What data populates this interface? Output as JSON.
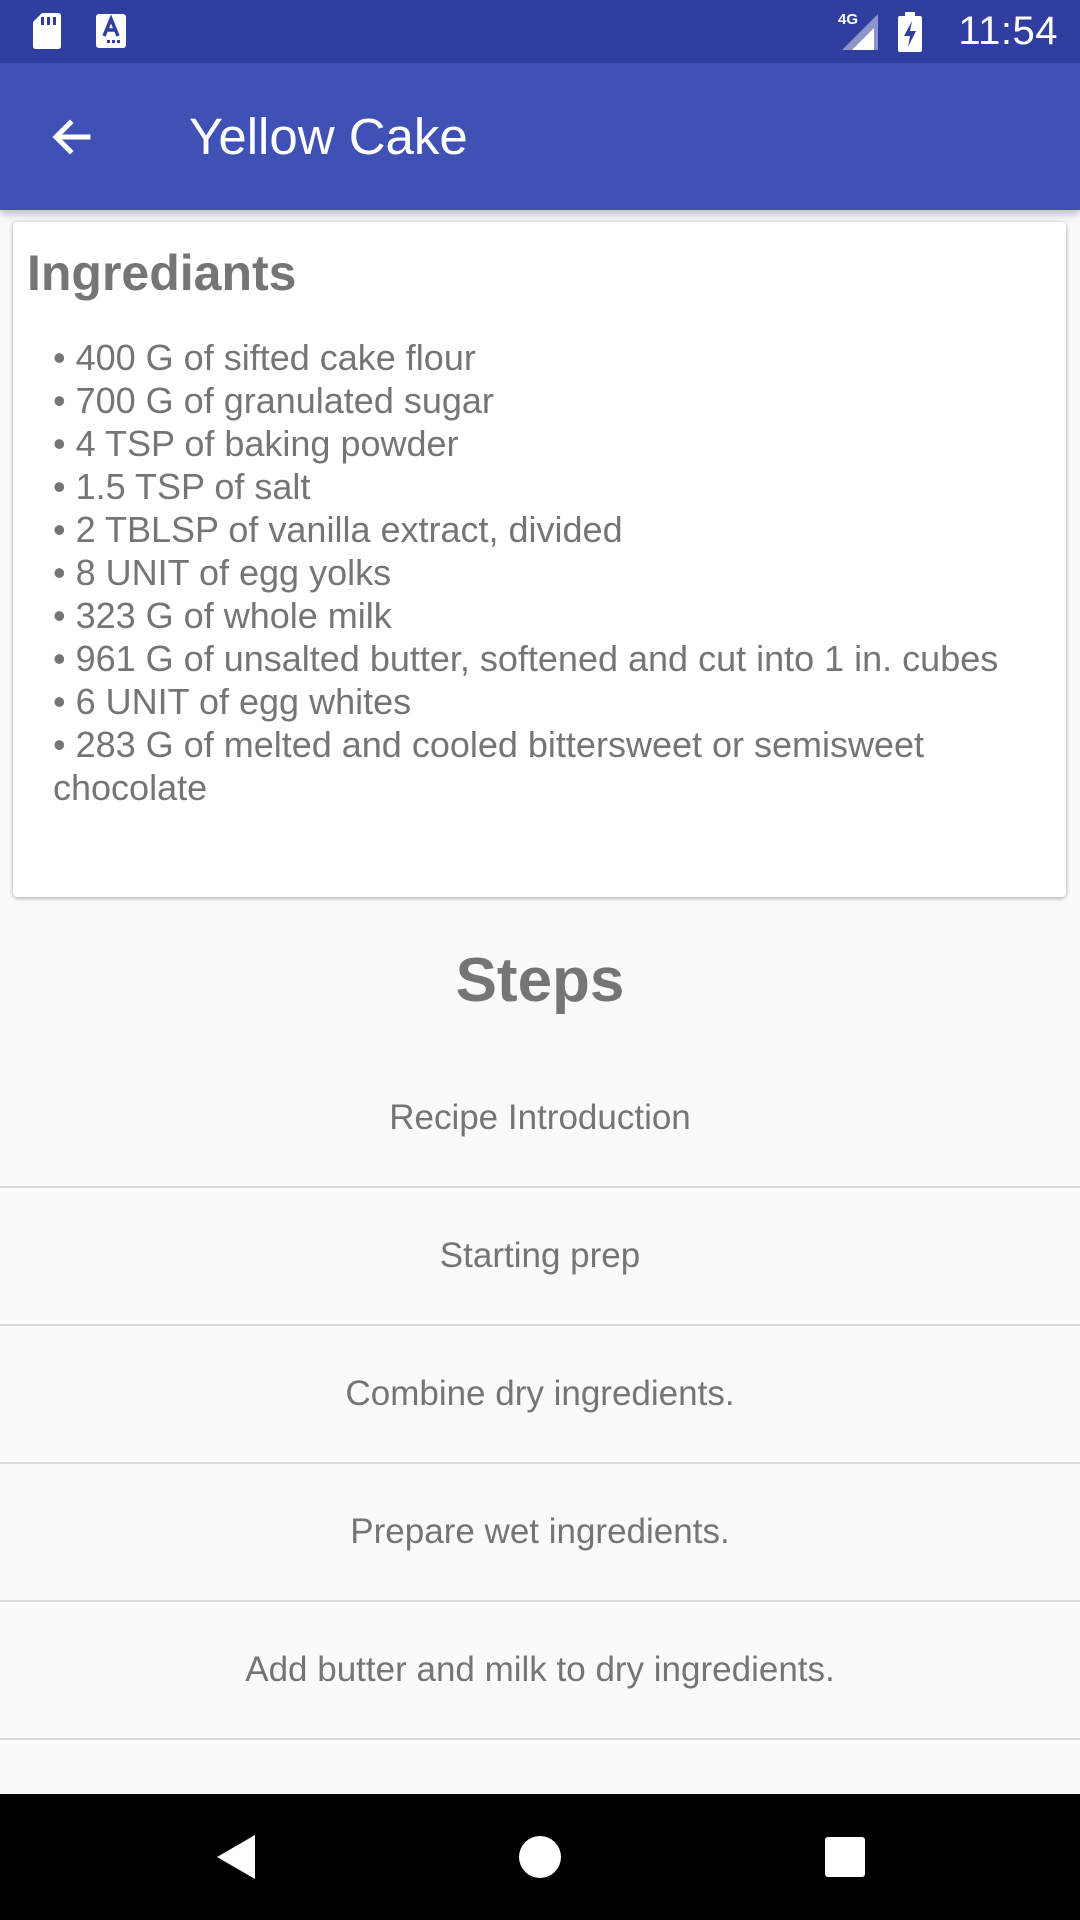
{
  "status_bar": {
    "time": "11:54",
    "network": "4G",
    "icons": [
      "sd-card-icon",
      "keyboard-a-icon",
      "signal-4g-icon",
      "battery-charging-icon"
    ]
  },
  "app_bar": {
    "title": "Yellow Cake",
    "back_icon": "arrow-back-icon"
  },
  "ingredients": {
    "heading": "Ingrediants",
    "items": [
      "400 G of sifted cake flour",
      "700 G of granulated sugar",
      "4 TSP of baking powder",
      "1.5 TSP of salt",
      "2 TBLSP of vanilla extract, divided",
      "8 UNIT of egg yolks",
      "323 G of whole milk",
      "961 G of unsalted butter, softened and cut into 1 in. cubes",
      "6 UNIT of egg whites",
      "283 G of melted and cooled bittersweet or semisweet chocolate"
    ]
  },
  "steps": {
    "heading": "Steps",
    "items": [
      "Recipe Introduction",
      "Starting prep",
      "Combine dry ingredients.",
      "Prepare wet ingredients.",
      "Add butter and milk to dry ingredients."
    ]
  },
  "nav_bar": {
    "icons": [
      "nav-back-icon",
      "nav-home-icon",
      "nav-recents-icon"
    ]
  },
  "colors": {
    "status_bar": "#303f9f",
    "app_bar": "#3f51b5",
    "text_secondary": "#757575",
    "background": "#fafafa"
  }
}
